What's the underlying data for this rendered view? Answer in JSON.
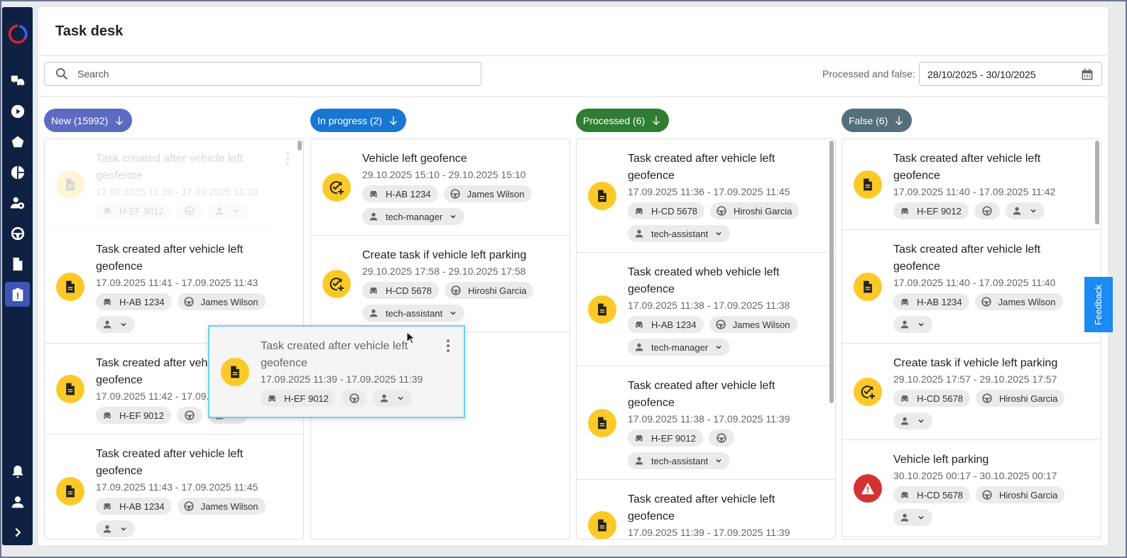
{
  "header": {
    "title": "Task desk"
  },
  "search": {
    "placeholder": "Search",
    "value": ""
  },
  "filter": {
    "label": "Processed and false:",
    "date_range": "28/10/2025 - 30/10/2025"
  },
  "feedback": "Feedback",
  "colors": {
    "sidebar": "#0e2142",
    "new": "#5c6bc0",
    "in_progress": "#1976d2",
    "processed": "#2e7d32",
    "false": "#546e7a",
    "task_icon": "#fcc928",
    "alert_icon": "#d63131"
  },
  "sidebar": {
    "items": [
      "vehicles-icon",
      "play-icon",
      "geofence-icon",
      "reports-icon",
      "drivers-icon",
      "steering-icon",
      "documents-icon",
      "task-desk-icon"
    ],
    "bottom": [
      "bell-icon",
      "user-icon",
      "expand-icon"
    ]
  },
  "columns": [
    {
      "label": "New (15992)",
      "color": "#5c6bc0",
      "cards": [
        {
          "ghost": true,
          "icon": "doc",
          "title": "Task created after vehicle left geofence",
          "date": "17.09.2025 11:39 - 17.09.2025 11:39",
          "vehicle": "H-EF 9012",
          "driver": "",
          "assignee": ""
        },
        {
          "icon": "doc",
          "title": "Task created after vehicle left geofence",
          "date": "17.09.2025 11:41 - 17.09.2025 11:43",
          "vehicle": "H-AB 1234",
          "driver": "James Wilson",
          "assignee": ""
        },
        {
          "icon": "doc",
          "title": "Task created after vehicle left geofence",
          "date": "17.09.2025 11:42 - 17.09.2025 11:43",
          "vehicle": "H-EF 9012",
          "driver": "",
          "assignee": ""
        },
        {
          "icon": "doc",
          "title": "Task created after vehicle left geofence",
          "date": "17.09.2025 11:43 - 17.09.2025 11:45",
          "vehicle": "H-AB 1234",
          "driver": "James Wilson",
          "assignee": ""
        }
      ]
    },
    {
      "label": "In progress (2)",
      "color": "#1976d2",
      "cards": [
        {
          "icon": "check",
          "title": "Vehicle left geofence",
          "date": "29.10.2025 15:10 - 29.10.2025 15:10",
          "vehicle": "H-AB 1234",
          "driver": "James Wilson",
          "assignee": "tech-manager"
        },
        {
          "icon": "check",
          "title": "Create task if vehicle left parking",
          "date": "29.10.2025 17:58 - 29.10.2025 17:58",
          "vehicle": "H-CD 5678",
          "driver": "Hiroshi Garcia",
          "assignee": "tech-assistant"
        }
      ]
    },
    {
      "label": "Processed (6)",
      "color": "#2e7d32",
      "cards": [
        {
          "icon": "doc",
          "title": "Task created after vehicle left geofence",
          "date": "17.09.2025 11:36 - 17.09.2025 11:45",
          "vehicle": "H-CD 5678",
          "driver": "Hiroshi Garcia",
          "assignee": "tech-assistant"
        },
        {
          "icon": "doc",
          "title": "Task created wheb vehicle left geofence",
          "date": "17.09.2025 11:38 - 17.09.2025 11:38",
          "vehicle": "H-AB 1234",
          "driver": "James Wilson",
          "assignee": "tech-manager"
        },
        {
          "icon": "doc",
          "title": "Task created after vehicle left geofence",
          "date": "17.09.2025 11:38 - 17.09.2025 11:39",
          "vehicle": "H-EF 9012",
          "driver": "",
          "assignee": "tech-assistant"
        },
        {
          "icon": "doc",
          "title": "Task created after vehicle left geofence",
          "date": "17.09.2025 11:39 - 17.09.2025 11:39",
          "vehicle": "",
          "driver": "",
          "assignee": ""
        }
      ]
    },
    {
      "label": "False (6)",
      "color": "#546e7a",
      "cards": [
        {
          "icon": "doc",
          "title": "Task created after vehicle left geofence",
          "date": "17.09.2025 11:40 - 17.09.2025 11:42",
          "vehicle": "H-EF 9012",
          "driver": "",
          "assignee": ""
        },
        {
          "icon": "doc",
          "title": "Task created after vehicle left geofence",
          "date": "17.09.2025 11:40 - 17.09.2025 11:40",
          "vehicle": "H-AB 1234",
          "driver": "James Wilson",
          "assignee": ""
        },
        {
          "icon": "check",
          "title": "Create task if vehicle left parking",
          "date": "29.10.2025 17:57 - 29.10.2025 17:57",
          "vehicle": "H-CD 5678",
          "driver": "Hiroshi Garcia",
          "assignee": ""
        },
        {
          "icon": "alert",
          "title": "Vehicle left parking",
          "date": "30.10.2025 00:17 - 30.10.2025 00:17",
          "vehicle": "H-CD 5678",
          "driver": "Hiroshi Garcia",
          "assignee": ""
        }
      ]
    }
  ],
  "dragging": {
    "icon": "doc",
    "title": "Task created after vehicle left geofence",
    "date": "17.09.2025 11:39 - 17.09.2025 11:39",
    "vehicle": "H-EF 9012",
    "driver": "",
    "assignee": ""
  }
}
